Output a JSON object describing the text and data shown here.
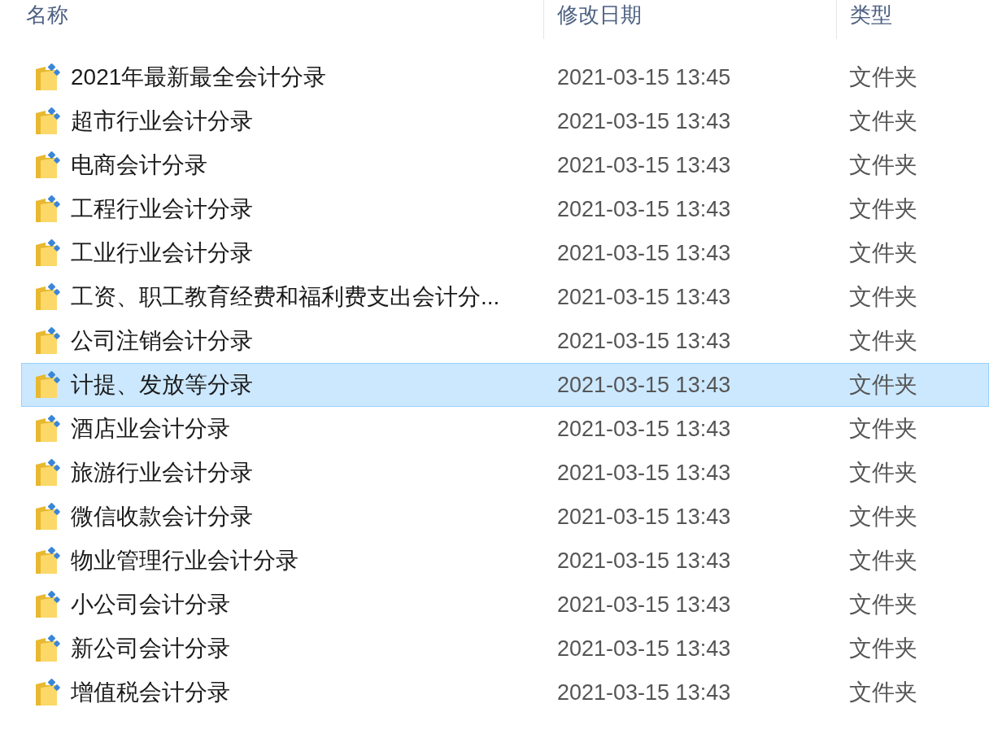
{
  "columns": [
    {
      "label": "名称"
    },
    {
      "label": "修改日期"
    },
    {
      "label": "类型"
    }
  ],
  "rows": [
    {
      "name": "2021年最新最全会计分录",
      "modified": "2021-03-15 13:45",
      "type": "文件夹",
      "selected": false
    },
    {
      "name": "超市行业会计分录",
      "modified": "2021-03-15 13:43",
      "type": "文件夹",
      "selected": false
    },
    {
      "name": "电商会计分录",
      "modified": "2021-03-15 13:43",
      "type": "文件夹",
      "selected": false
    },
    {
      "name": "工程行业会计分录",
      "modified": "2021-03-15 13:43",
      "type": "文件夹",
      "selected": false
    },
    {
      "name": "工业行业会计分录",
      "modified": "2021-03-15 13:43",
      "type": "文件夹",
      "selected": false
    },
    {
      "name": "工资、职工教育经费和福利费支出会计分...",
      "modified": "2021-03-15 13:43",
      "type": "文件夹",
      "selected": false
    },
    {
      "name": "公司注销会计分录",
      "modified": "2021-03-15 13:43",
      "type": "文件夹",
      "selected": false
    },
    {
      "name": "计提、发放等分录",
      "modified": "2021-03-15 13:43",
      "type": "文件夹",
      "selected": true
    },
    {
      "name": "酒店业会计分录",
      "modified": "2021-03-15 13:43",
      "type": "文件夹",
      "selected": false
    },
    {
      "name": "旅游行业会计分录",
      "modified": "2021-03-15 13:43",
      "type": "文件夹",
      "selected": false
    },
    {
      "name": "微信收款会计分录",
      "modified": "2021-03-15 13:43",
      "type": "文件夹",
      "selected": false
    },
    {
      "name": "物业管理行业会计分录",
      "modified": "2021-03-15 13:43",
      "type": "文件夹",
      "selected": false
    },
    {
      "name": "小公司会计分录",
      "modified": "2021-03-15 13:43",
      "type": "文件夹",
      "selected": false
    },
    {
      "name": "新公司会计分录",
      "modified": "2021-03-15 13:43",
      "type": "文件夹",
      "selected": false
    },
    {
      "name": "增值税会计分录",
      "modified": "2021-03-15 13:43",
      "type": "文件夹",
      "selected": false
    }
  ]
}
